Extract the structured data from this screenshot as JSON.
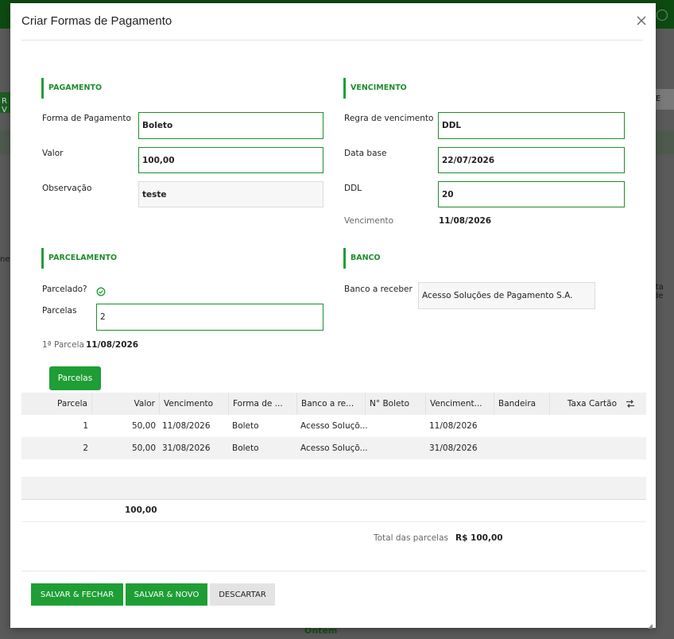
{
  "dialog": {
    "title": "Criar Formas de Pagamento"
  },
  "pagamento": {
    "section": "PAGAMENTO",
    "forma_label": "Forma de Pagamento",
    "forma_value": "Boleto",
    "valor_label": "Valor",
    "valor_value": "100,00",
    "obs_label": "Observação",
    "obs_value": "teste"
  },
  "vencimento": {
    "section": "VENCIMENTO",
    "regra_label": "Regra de vencimento",
    "regra_value": "DDL",
    "data_base_label": "Data base",
    "data_base_value": "22/07/2026",
    "ddl_label": "DDL",
    "ddl_value": "20",
    "venc_label": "Vencimento",
    "venc_value": "11/08/2026"
  },
  "parcelamento": {
    "section": "PARCELAMENTO",
    "parcelado_label": "Parcelado?",
    "parcelas_label": "Parcelas",
    "parcelas_value": "2",
    "primeira_label": "1ª Parcela",
    "primeira_value": "11/08/2026"
  },
  "banco": {
    "section": "BANCO",
    "receber_label": "Banco a receber",
    "receber_value": "Acesso Soluções de Pagamento S.A."
  },
  "tabs": {
    "parcelas": "Parcelas"
  },
  "grid": {
    "headers": [
      "Parcela",
      "Valor",
      "Vencimento",
      "Forma de ...",
      "Banco a re...",
      "N° Boleto",
      "Venciment...",
      "Bandeira",
      "Taxa Cartão"
    ],
    "rows": [
      {
        "parcela": "1",
        "valor": "50,00",
        "vencimento": "11/08/2026",
        "forma": "Boleto",
        "banco": "Acesso Soluçõ...",
        "boleto": "",
        "venc_orig": "11/08/2026",
        "bandeira": "",
        "taxa": ""
      },
      {
        "parcela": "2",
        "valor": "50,00",
        "vencimento": "31/08/2026",
        "forma": "Boleto",
        "banco": "Acesso Soluçõ...",
        "boleto": "",
        "venc_orig": "31/08/2026",
        "bandeira": "",
        "taxa": ""
      }
    ],
    "total_valor": "100,00",
    "total_label": "Total das parcelas",
    "total_value": "R$ 100,00"
  },
  "buttons": {
    "salvar_fechar": "SALVAR & FECHAR",
    "salvar_novo": "SALVAR & NOVO",
    "descartar": "DESCARTAR"
  },
  "background": {
    "bottom_text": "Ontem",
    "left_fragment": "nes",
    "right_fragment": "ita de",
    "right_button": "E",
    "left_button": "R V"
  },
  "colors": {
    "accent": "#1e9e35",
    "accent_text": "#1e8e2c"
  }
}
